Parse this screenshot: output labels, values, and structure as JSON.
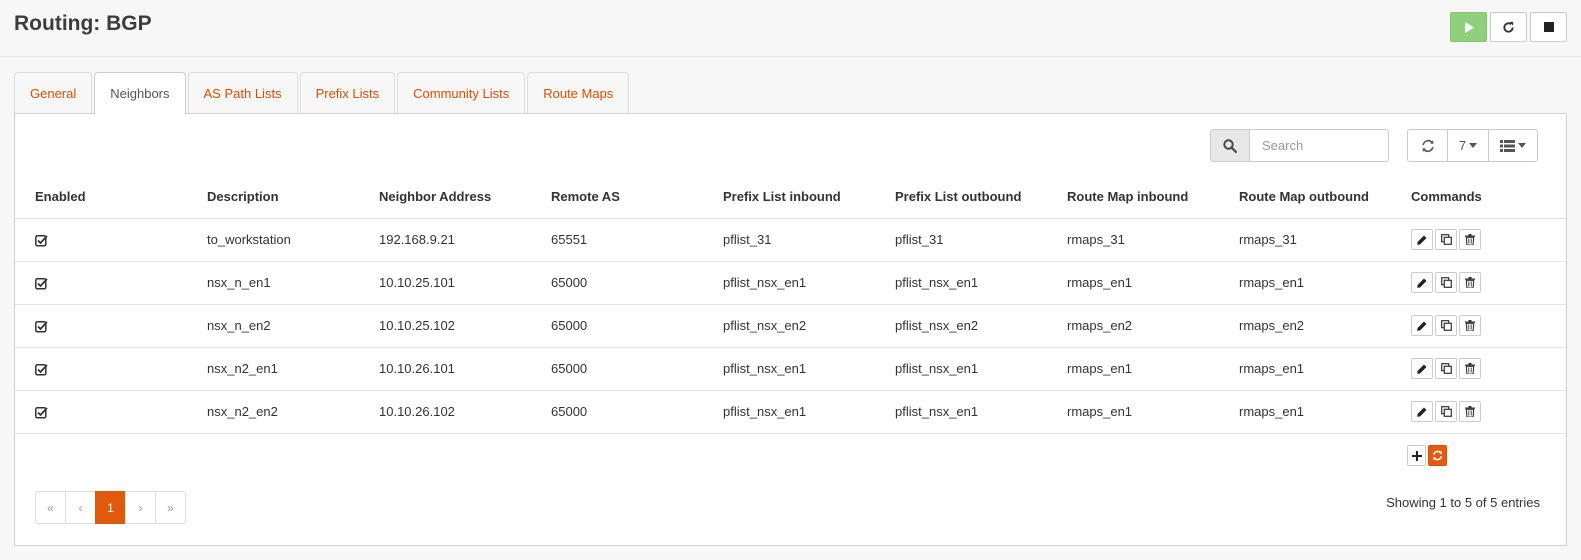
{
  "header": {
    "title": "Routing: BGP"
  },
  "service_buttons": [
    "play-icon",
    "reload-icon",
    "stop-icon"
  ],
  "tabs": [
    {
      "label": "General",
      "active": false
    },
    {
      "label": "Neighbors",
      "active": true
    },
    {
      "label": "AS Path Lists",
      "active": false
    },
    {
      "label": "Prefix Lists",
      "active": false
    },
    {
      "label": "Community Lists",
      "active": false
    },
    {
      "label": "Route Maps",
      "active": false
    }
  ],
  "toolbar": {
    "search_placeholder": "Search",
    "page_size": "7"
  },
  "table": {
    "columns": [
      "Enabled",
      "Description",
      "Neighbor Address",
      "Remote AS",
      "Prefix List inbound",
      "Prefix List outbound",
      "Route Map inbound",
      "Route Map outbound",
      "Commands"
    ],
    "rows": [
      {
        "enabled": true,
        "description": "to_workstation",
        "address": "192.168.9.21",
        "remote_as": "65551",
        "pl_in": "pflist_31",
        "pl_out": "pflist_31",
        "rm_in": "rmaps_31",
        "rm_out": "rmaps_31"
      },
      {
        "enabled": true,
        "description": "nsx_n_en1",
        "address": "10.10.25.101",
        "remote_as": "65000",
        "pl_in": "pflist_nsx_en1",
        "pl_out": "pflist_nsx_en1",
        "rm_in": "rmaps_en1",
        "rm_out": "rmaps_en1"
      },
      {
        "enabled": true,
        "description": "nsx_n_en2",
        "address": "10.10.25.102",
        "remote_as": "65000",
        "pl_in": "pflist_nsx_en2",
        "pl_out": "pflist_nsx_en2",
        "rm_in": "rmaps_en2",
        "rm_out": "rmaps_en2"
      },
      {
        "enabled": true,
        "description": "nsx_n2_en1",
        "address": "10.10.26.101",
        "remote_as": "65000",
        "pl_in": "pflist_nsx_en1",
        "pl_out": "pflist_nsx_en1",
        "rm_in": "rmaps_en1",
        "rm_out": "rmaps_en1"
      },
      {
        "enabled": true,
        "description": "nsx_n2_en2",
        "address": "10.10.26.102",
        "remote_as": "65000",
        "pl_in": "pflist_nsx_en1",
        "pl_out": "pflist_nsx_en1",
        "rm_in": "rmaps_en1",
        "rm_out": "rmaps_en1"
      }
    ]
  },
  "pagination": {
    "first": "«",
    "prev": "‹",
    "current": "1",
    "next": "›",
    "last": "»"
  },
  "info": "Showing 1 to 5 of 5 entries",
  "colors": {
    "accent": "#e05a0c",
    "play": "#8fd07d",
    "tab_text": "#d94f00"
  }
}
